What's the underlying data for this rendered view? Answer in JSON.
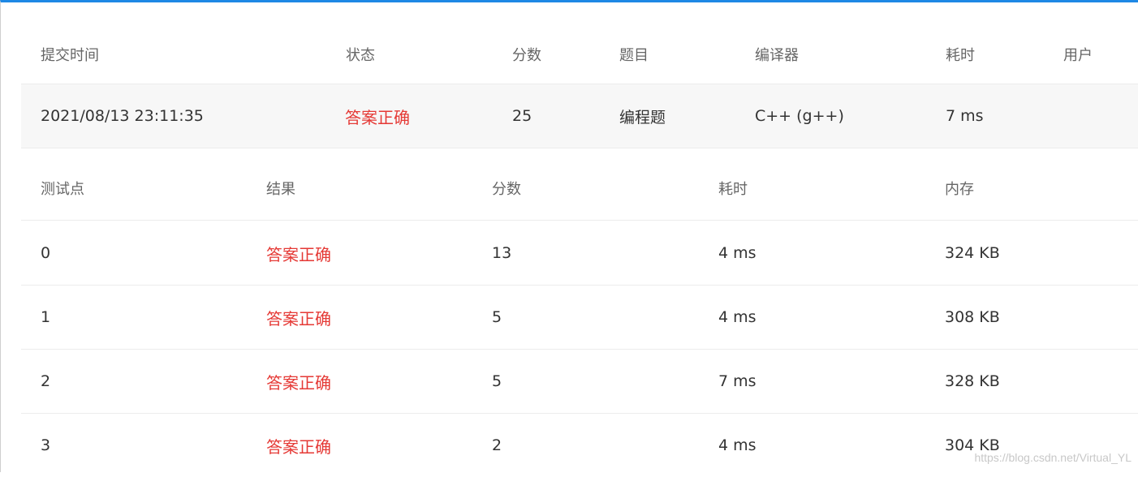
{
  "summary": {
    "headers": {
      "time": "提交时间",
      "status": "状态",
      "score": "分数",
      "problem": "题目",
      "compiler": "编译器",
      "elapsed": "耗时",
      "user": "用户"
    },
    "row": {
      "time": "2021/08/13 23:11:35",
      "status": "答案正确",
      "score": "25",
      "problem": "编程题",
      "compiler": "C++ (g++)",
      "elapsed": "7 ms",
      "user": ""
    }
  },
  "cases": {
    "headers": {
      "id": "测试点",
      "result": "结果",
      "score": "分数",
      "elapsed": "耗时",
      "memory": "内存"
    },
    "rows": [
      {
        "id": "0",
        "result": "答案正确",
        "score": "13",
        "elapsed": "4 ms",
        "memory": "324 KB"
      },
      {
        "id": "1",
        "result": "答案正确",
        "score": "5",
        "elapsed": "4 ms",
        "memory": "308 KB"
      },
      {
        "id": "2",
        "result": "答案正确",
        "score": "5",
        "elapsed": "7 ms",
        "memory": "328 KB"
      },
      {
        "id": "3",
        "result": "答案正确",
        "score": "2",
        "elapsed": "4 ms",
        "memory": "304 KB"
      }
    ]
  },
  "watermark": "https://blog.csdn.net/Virtual_YL",
  "colors": {
    "accent": "#1e88e5",
    "status_ok": "#e53935"
  }
}
